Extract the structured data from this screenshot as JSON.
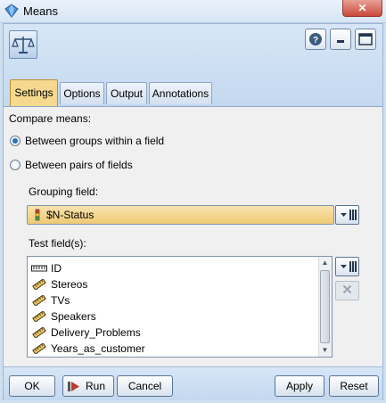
{
  "window": {
    "title": "Means",
    "close_glyph": "✕"
  },
  "header": {
    "node_icon": "balance-scale-icon",
    "help_icon": "help-icon",
    "minimize_icon": "minimize-icon",
    "maximize_icon": "maximize-icon"
  },
  "tabs": [
    {
      "label": "Settings",
      "active": true
    },
    {
      "label": "Options",
      "active": false
    },
    {
      "label": "Output",
      "active": false
    },
    {
      "label": "Annotations",
      "active": false
    }
  ],
  "settings": {
    "compare_means_label": "Compare means:",
    "radio_groups_label": "Between groups within a field",
    "radio_pairs_label": "Between pairs of fields",
    "selected_mode": "groups",
    "grouping_field_label": "Grouping field:",
    "grouping_field_value": "$N-Status",
    "test_fields_label": "Test field(s):",
    "test_fields": [
      {
        "name": "ID",
        "type_icon": "continuous-ruler-icon"
      },
      {
        "name": "Stereos",
        "type_icon": "nominal-ruler-icon"
      },
      {
        "name": "TVs",
        "type_icon": "nominal-ruler-icon"
      },
      {
        "name": "Speakers",
        "type_icon": "nominal-ruler-icon"
      },
      {
        "name": "Delivery_Problems",
        "type_icon": "nominal-ruler-icon"
      },
      {
        "name": "Years_as_customer",
        "type_icon": "nominal-ruler-icon"
      }
    ],
    "remove_glyph": "✕"
  },
  "footer": {
    "ok": "OK",
    "run": "Run",
    "cancel": "Cancel",
    "apply": "Apply",
    "reset": "Reset"
  },
  "colors": {
    "accent_tab": "#f6d98e",
    "combo_fill": "#efc973",
    "radio_dot": "#2f6fb8"
  }
}
